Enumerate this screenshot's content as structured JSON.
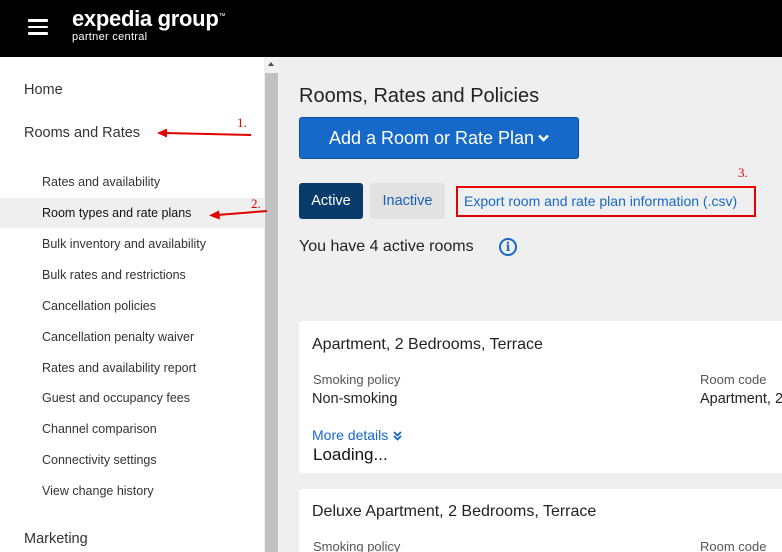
{
  "header": {
    "logo_main": "expedia group",
    "logo_tm": "™",
    "logo_sub": "partner central"
  },
  "sidebar": {
    "home": "Home",
    "rooms_and_rates": "Rooms and Rates",
    "sub_items": [
      "Rates and availability",
      "Room types and rate plans",
      "Bulk inventory and availability",
      "Bulk rates and restrictions",
      "Cancellation policies",
      "Cancellation penalty waiver",
      "Rates and availability report",
      "Guest and occupancy fees",
      "Channel comparison",
      "Connectivity settings",
      "View change history"
    ],
    "active_item": "Room types and rate plans",
    "marketing": "Marketing"
  },
  "main": {
    "title": "Rooms, Rates and Policies",
    "add_button": "Add a Room or Rate Plan",
    "tab_active": "Active",
    "tab_inactive": "Inactive",
    "export_link": "Export room and rate plan information (.csv)",
    "active_count_text": "You have 4 active rooms",
    "info_icon_glyph": "i",
    "cards": [
      {
        "title": "Apartment, 2 Bedrooms, Terrace",
        "smoking_label": "Smoking policy",
        "smoking_value": "Non-smoking",
        "room_code_label": "Room code",
        "room_code_value": "Apartment, 2",
        "more_details": "More details",
        "loading": "Loading..."
      },
      {
        "title": "Deluxe Apartment, 2 Bedrooms, Terrace",
        "smoking_label": "Smoking policy",
        "room_code_label": "Room code"
      }
    ]
  },
  "annotations": {
    "n1": "1.",
    "n2": "2.",
    "n3": "3.",
    "color": "#e30000"
  },
  "colors": {
    "topbar": "#000000",
    "primary": "#1668c9",
    "active_tab": "#0a3c6b"
  }
}
